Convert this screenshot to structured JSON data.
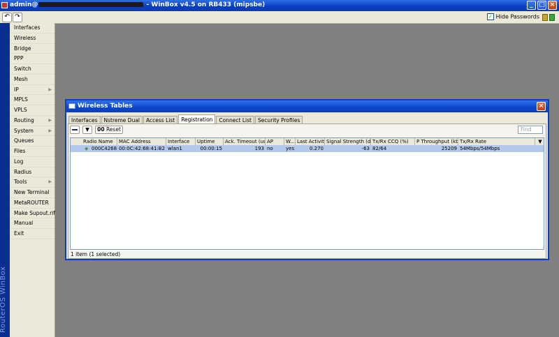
{
  "window": {
    "title_prefix": "admin@",
    "title_suffix": " - WinBox v4.5 on RB433 (mipsbe)"
  },
  "toolbar": {
    "undo_icon": "undo-icon",
    "redo_icon": "redo-icon",
    "hide_passwords_label": "Hide Passwords",
    "hide_passwords_checked": true
  },
  "brand": "RouterOS WinBox",
  "menu": [
    {
      "label": "Interfaces",
      "submenu": false
    },
    {
      "label": "Wireless",
      "submenu": false
    },
    {
      "label": "Bridge",
      "submenu": false
    },
    {
      "label": "PPP",
      "submenu": false
    },
    {
      "label": "Switch",
      "submenu": false
    },
    {
      "label": "Mesh",
      "submenu": false
    },
    {
      "label": "IP",
      "submenu": true
    },
    {
      "label": "MPLS",
      "submenu": false
    },
    {
      "label": "VPLS",
      "submenu": false
    },
    {
      "label": "Routing",
      "submenu": true
    },
    {
      "label": "System",
      "submenu": true
    },
    {
      "label": "Queues",
      "submenu": false
    },
    {
      "label": "Files",
      "submenu": false
    },
    {
      "label": "Log",
      "submenu": false
    },
    {
      "label": "Radius",
      "submenu": false
    },
    {
      "label": "Tools",
      "submenu": true
    },
    {
      "label": "New Terminal",
      "submenu": false
    },
    {
      "label": "MetaROUTER",
      "submenu": false
    },
    {
      "label": "Make Supout.rif",
      "submenu": false
    },
    {
      "label": "Manual",
      "submenu": false
    },
    {
      "label": "Exit",
      "submenu": false
    }
  ],
  "wt": {
    "title": "Wireless Tables",
    "tabs": [
      "Interfaces",
      "Nstreme Dual",
      "Access List",
      "Registration",
      "Connect List",
      "Security Profiles"
    ],
    "active_tab": 3,
    "reset_label": "Reset",
    "reset_prefix": "00",
    "find_placeholder": "Find",
    "columns": [
      "Radio Name",
      "MAC Address",
      "Interface",
      "Uptime",
      "Ack. Timeout (us)",
      "AP",
      "W...",
      "Last Activit...",
      "Signal Strength (dBm)",
      "Tx/Rx CCQ (%)",
      "P Throughput (kb...",
      "Tx/Rx Rate"
    ],
    "rows": [
      [
        "000C4268...",
        "00:0C:42:68:41:B2",
        "wlan1",
        "00:00:15",
        "193",
        "no",
        "yes",
        "0.270",
        "-63",
        "82/64",
        "25209",
        "54Mbps/54Mbps"
      ]
    ],
    "status": "1 item (1 selected)"
  }
}
